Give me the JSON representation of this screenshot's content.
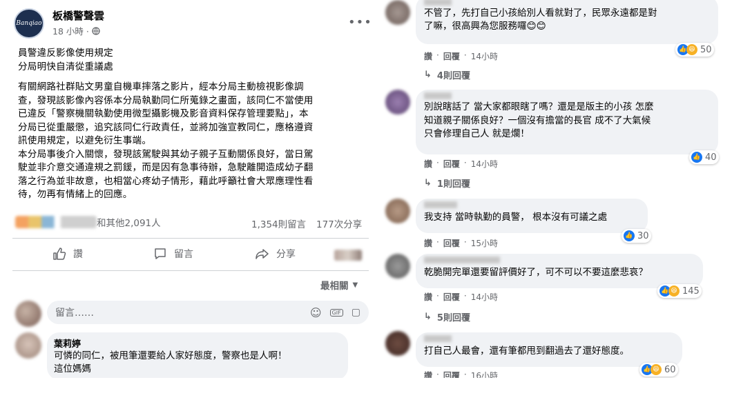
{
  "post": {
    "page_name": "板橋警聲雲",
    "avatar_text": "Banqiao",
    "time": "18 小時 ·",
    "privacy_icon": "globe-icon",
    "more_icon": "more-dots-icon",
    "title_lines": [
      "員警違反影像使用規定",
      "分局明快自清從重議處"
    ],
    "body_lines": [
      "有關網路社群貼文男童自機車摔落之影片，經本分局主動檢視影像調",
      "查，發現該影像內容係本分局執勤同仁所蒐錄之畫面，該同仁不當使用",
      "已違反「警察機關執勤使用微型攝影機及影音資料保存管理要點」，本",
      "分局已從重嚴懲，追究該同仁行政責任，並將加強宣教同仁，應格遵資",
      "訊使用規定，以避免衍生事端。",
      "本分局事後介入關懷，發現該駕駛與其幼子親子互動關係良好，當日駕",
      "駛並非介意交通違規之罰鍰，而是因有急事待辦，急駛離開造成幼子翻",
      "落之行為並非故意，也相當心疼幼子情形，藉此呼籲社會大眾應理性看",
      "待，勿再有情緒上的回應。"
    ],
    "reactions_text": "和其他2,091人",
    "comments_count": "1,354則留言",
    "shares_count": "177次分享",
    "actions": {
      "like": "讚",
      "comment": "留言",
      "share": "分享"
    },
    "sort_label": "最相關",
    "comment_input_placeholder": "留言……"
  },
  "left_comments": [
    {
      "name": "葉莉婷",
      "lines": [
        "可憐的同仁，被甩筆還要給人家好態度，警察也是人啊！",
        "這位媽媽"
      ]
    }
  ],
  "right_comments": [
    {
      "lines": [
        "不管了，先打自己小孩給別人看就對了，民眾永遠都是對",
        "了嘛，很高興為您服務囉😊😊"
      ],
      "meta_like": "讚",
      "meta_reply": "回覆",
      "meta_time": "14小時",
      "count": "50",
      "icons": [
        "like",
        "haha"
      ],
      "replies": "4則回覆"
    },
    {
      "lines": [
        "別說瞎話了 當大家都眼瞎了嗎？還是是版主的小孩 怎麼",
        "知道親子關係良好？一個沒有擔當的長官 成不了大氣候",
        "只會修理自己人 就是爛！"
      ],
      "meta_like": "讚",
      "meta_reply": "回覆",
      "meta_time": "14小時",
      "count": "40",
      "icons": [
        "like"
      ],
      "replies": "1則回覆"
    },
    {
      "lines": [
        "我支持 當時執勤的員警， 根本沒有可議之處"
      ],
      "meta_like": "讚",
      "meta_reply": "回覆",
      "meta_time": "15小時",
      "count": "30",
      "icons": [
        "like"
      ],
      "replies": ""
    },
    {
      "lines": [
        "乾脆開完單還要留評價好了，可不可以不要這麼悲哀？"
      ],
      "meta_like": "讚",
      "meta_reply": "回覆",
      "meta_time": "14小時",
      "count": "145",
      "icons": [
        "like",
        "haha"
      ],
      "replies": "5則回覆"
    },
    {
      "lines": [
        "打自己人最會，還有筆都甩到翻過去了還好態度。"
      ],
      "meta_like": "讚",
      "meta_reply": "回覆",
      "meta_time": "16小時",
      "count": "60",
      "icons": [
        "like",
        "haha"
      ],
      "replies": ""
    }
  ]
}
